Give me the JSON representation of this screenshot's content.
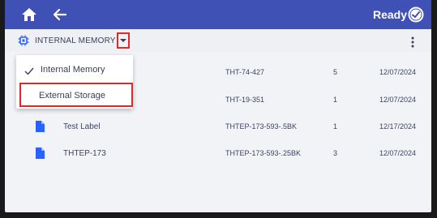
{
  "topbar": {
    "status_label": "Ready"
  },
  "toolbar": {
    "storage_label": "INTERNAL MEMORY"
  },
  "dropdown": {
    "options": [
      {
        "label": "Internal Memory",
        "selected": true
      },
      {
        "label": "External Storage",
        "selected": false
      }
    ]
  },
  "files": [
    {
      "name": "",
      "part": "THT-74-427",
      "qty": "5",
      "date": "12/07/2024"
    },
    {
      "name": "",
      "part": "THT-19-351",
      "qty": "1",
      "date": "12/07/2024"
    },
    {
      "name": "Test Label",
      "part": "THTEP-173-593-.5BK",
      "qty": "1",
      "date": "12/17/2024"
    },
    {
      "name": "THTEP-173",
      "part": "THTEP-173-593-.25BK",
      "qty": "3",
      "date": "12/07/2024"
    }
  ],
  "colors": {
    "topbar": "#3f51b5",
    "accent": "#2962ff",
    "highlight_box": "#e32626",
    "background": "#f2f3f7"
  },
  "icons": {
    "home": "home-icon",
    "back": "back-arrow-icon",
    "ready": "check-circle-icon",
    "memory": "memory-chip-icon",
    "dropdown": "chevron-down-icon",
    "menu": "kebab-menu-icon",
    "file": "file-icon",
    "check": "check-icon"
  }
}
